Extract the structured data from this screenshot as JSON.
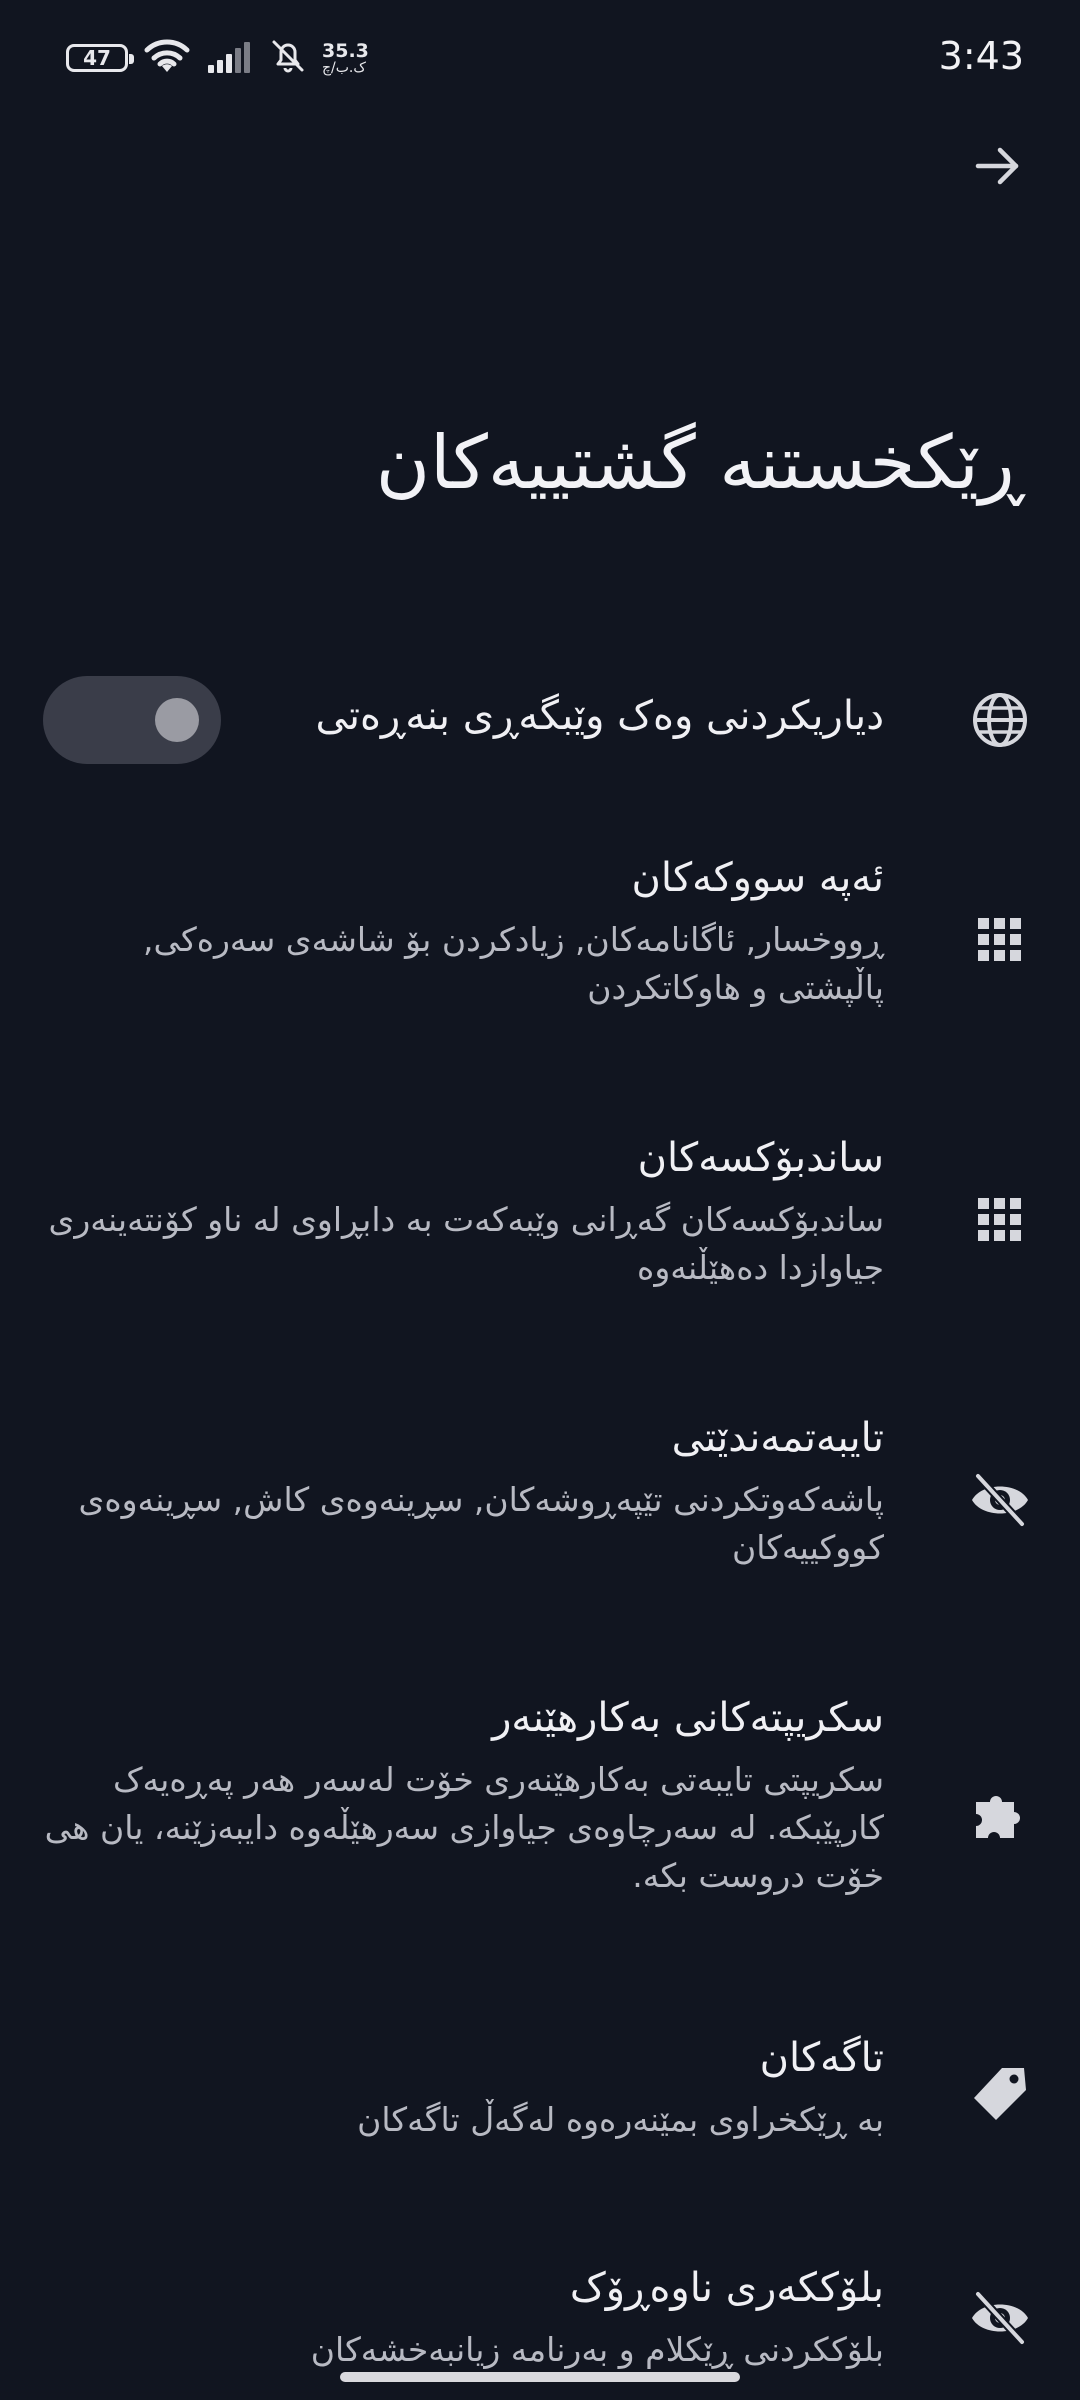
{
  "status_bar": {
    "time": "3:43",
    "battery_level": "47",
    "net_speed_value": "35.3",
    "net_speed_unit": "ک.ب/چ",
    "icons": [
      "battery-icon",
      "wifi-icon",
      "signal-icon",
      "bell-muted-icon"
    ]
  },
  "header": {
    "forward_icon": "arrow-right-icon",
    "title": "ڕێکخستنە گشتییەکان"
  },
  "settings": [
    {
      "icon": "globe-icon",
      "title": "دیاریکردنی وەک وێبگەڕی بنەڕەتی",
      "subtitle": "",
      "toggle": false
    },
    {
      "icon": "grid-icon",
      "title": "ئەپە سووکەکان",
      "subtitle": "ڕووخسار, ئاگانامەکان, زیادکردن بۆ شاشەی سەرەکی, پاڵپشتی و هاوکاتکردن"
    },
    {
      "icon": "grid-icon",
      "title": "ساندبۆکسەکان",
      "subtitle": "ساندبۆکسەکان گەڕانی وێبەکەت بە دابڕاوی لە ناو کۆنتەینەری جیاوازدا دەهێڵنەوە"
    },
    {
      "icon": "eye-off-icon",
      "title": "تایبەتمەندێتی",
      "subtitle": "پاشەکەوتکردنی تێپەڕوشەکان, سڕینەوەی کاش, سڕینەوەی کووکییەکان"
    },
    {
      "icon": "puzzle-icon",
      "title": "سکریپتەکانی بەکارهێنەر",
      "subtitle": "سکریپتی تایبەتی بەکارهێنەری خۆت لەسەر هەر پەڕەیەک کارپێبکە. لە سەرچاوەی جیاوازی سەرهێڵەوە دایبەزێنە، یان هی خۆت دروست بکە."
    },
    {
      "icon": "tag-icon",
      "title": "تاگەکان",
      "subtitle": "بە ڕێکخراوی بمێنەرەوە لەگەڵ تاگەکان"
    },
    {
      "icon": "eye-off-icon",
      "title": "بلۆککەری ناوەڕۆک",
      "subtitle": "بلۆککردنی ڕێکلام و بەرنامە زیانبەخشەکان"
    }
  ]
}
